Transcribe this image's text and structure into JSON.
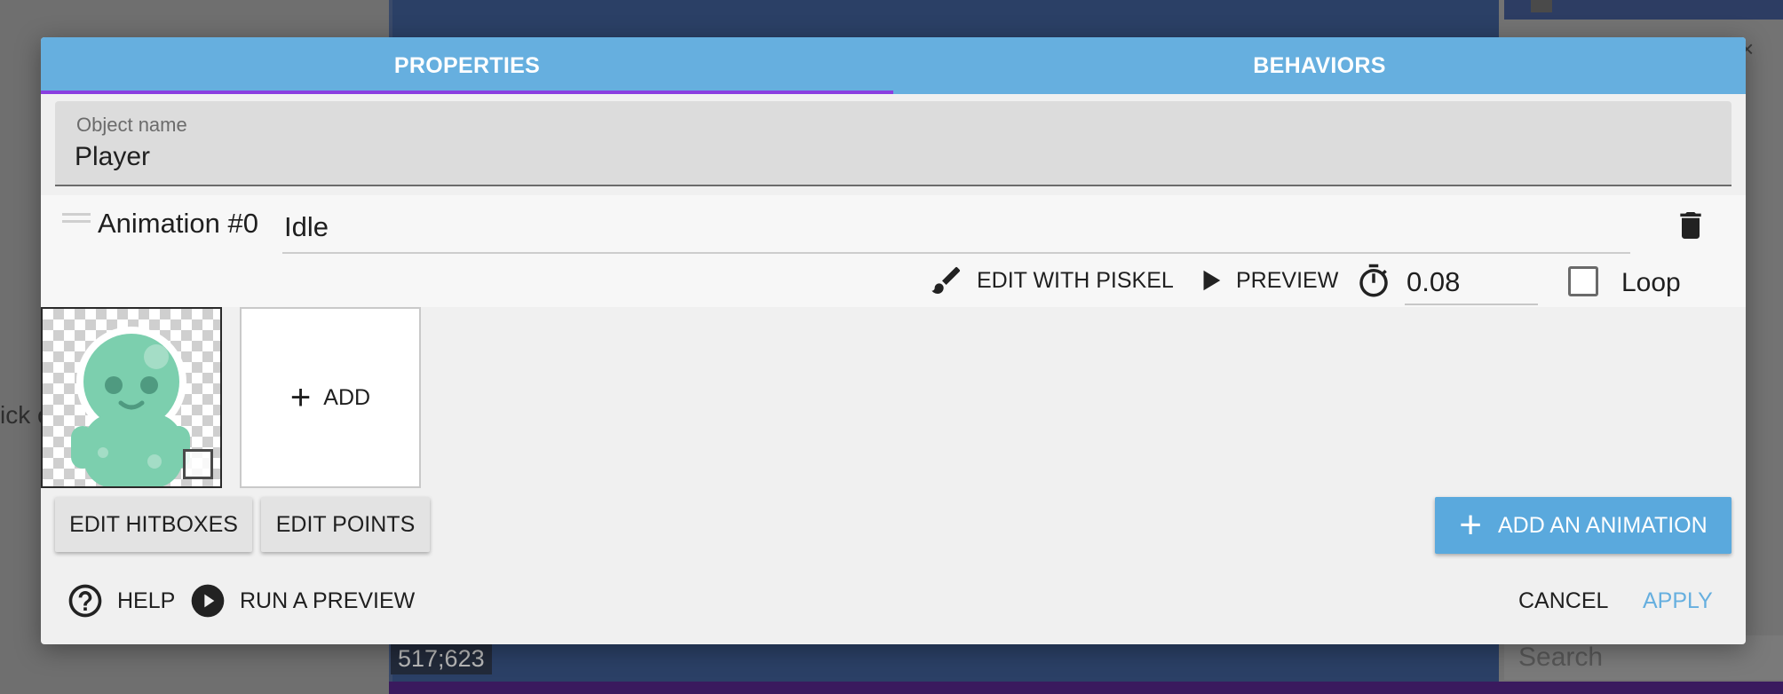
{
  "background": {
    "left_text": "ick c",
    "coords": "517;623",
    "search_placeholder": "Search"
  },
  "tabs": [
    {
      "label": "PROPERTIES",
      "active": true
    },
    {
      "label": "BEHAVIORS",
      "active": false
    }
  ],
  "object_name": {
    "label": "Object name",
    "value": "Player"
  },
  "animation": {
    "title": "Animation #0",
    "name": "Idle",
    "edit_with_piskel_label": "EDIT WITH PISKEL",
    "preview_label": "PREVIEW",
    "timer_value": "0.08",
    "loop_label": "Loop",
    "loop_checked": false
  },
  "frames": {
    "add_label": "ADD"
  },
  "buttons": {
    "edit_hitboxes": "EDIT HITBOXES",
    "edit_points": "EDIT POINTS",
    "add_animation": "ADD AN ANIMATION"
  },
  "footer": {
    "help": "HELP",
    "run_preview": "RUN A PREVIEW",
    "cancel": "CANCEL",
    "apply": "APPLY"
  },
  "colors": {
    "accent": "#66afdf",
    "tab_indicator": "#8a3fe0",
    "sprite_green": "#7ccfae"
  },
  "icons": {
    "drag": "drag-handle-icon",
    "trash": "trash-icon",
    "piskel": "paintbrush-icon",
    "preview": "play-icon",
    "timer": "timer-icon",
    "help": "help-circle-icon",
    "run_preview": "play-circle-icon",
    "add": "plus-icon"
  }
}
